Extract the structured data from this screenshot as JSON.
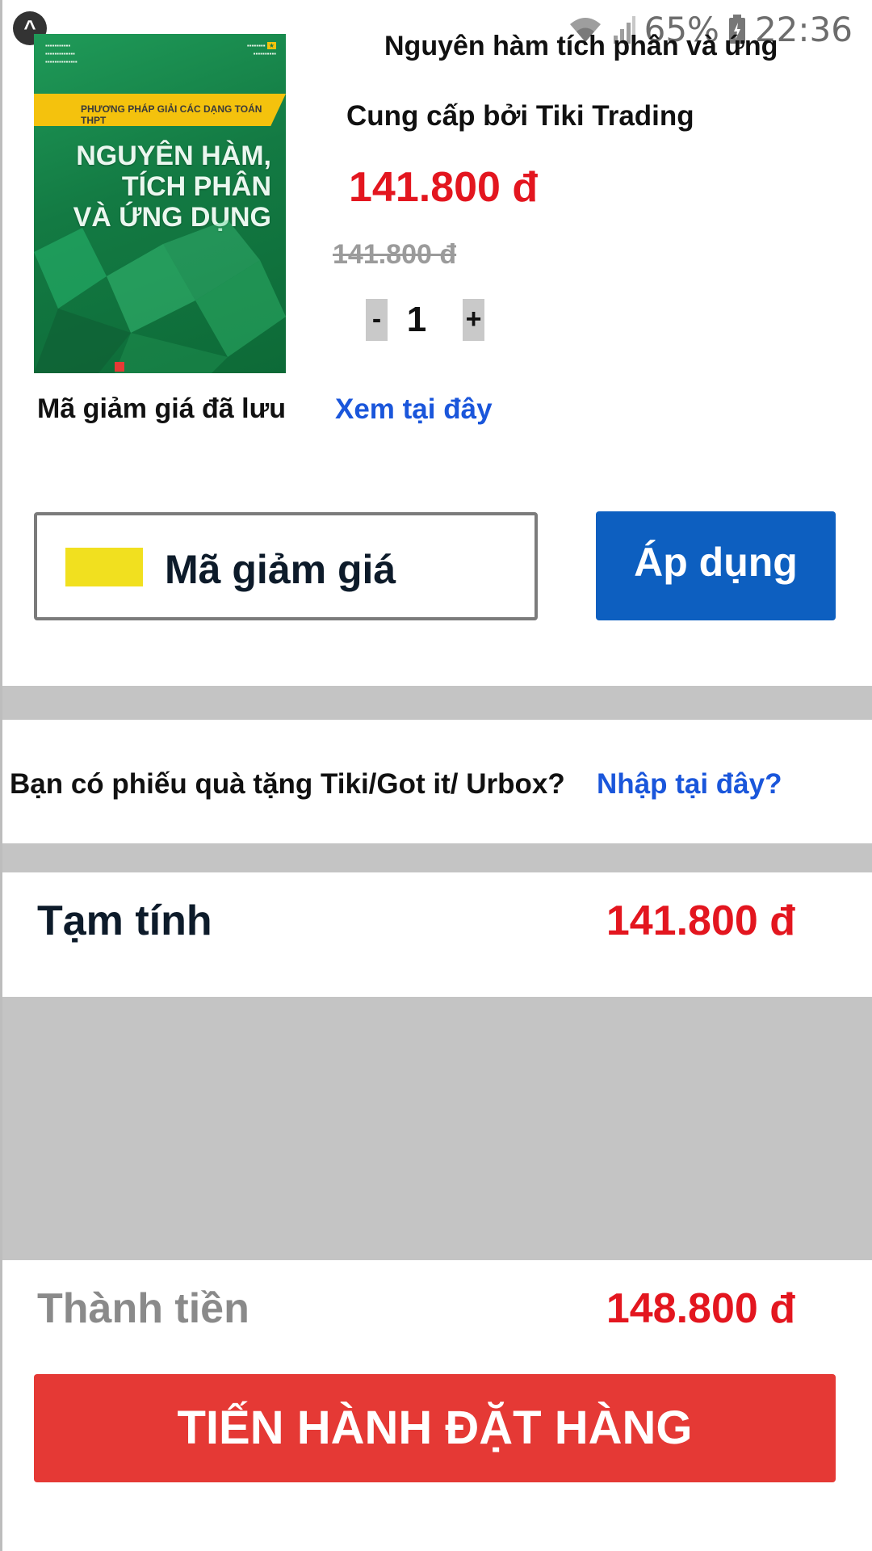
{
  "status_bar": {
    "app_badge": "^",
    "battery": "65%",
    "time": "22:36",
    "icons": [
      "wifi-icon",
      "signal-icon",
      "battery-icon"
    ]
  },
  "product": {
    "cover": {
      "top_left_text": "",
      "strip_text": "PHƯƠNG PHÁP GIẢI CÁC DẠNG TOÁN THPT",
      "title_line1": "NGUYÊN HÀM,",
      "title_line2": "TÍCH PHÂN",
      "title_line3": "VÀ ỨNG DỤNG"
    },
    "title": "Nguyên hàm tích phân và ứng",
    "seller": "Cung cấp bởi Tiki Trading",
    "price": "141.800 đ",
    "old_price": "141.800 đ",
    "qty_minus": "-",
    "quantity": "1",
    "qty_plus": "+"
  },
  "coupon": {
    "saved_label": "Mã giảm giá đã lưu",
    "view_link": "Xem tại đây",
    "placeholder": "Mã giảm giá",
    "apply_label": "Áp dụng"
  },
  "gift": {
    "question": "Bạn có phiếu quà tặng Tiki/Got it/ Urbox?",
    "link": "Nhập tại đây?"
  },
  "summary": {
    "subtotal_label": "Tạm tính",
    "subtotal_value": "141.800 đ",
    "total_label": "Thành tiền",
    "total_value": "148.800 đ"
  },
  "checkout_label": "TIẾN HÀNH ĐẶT HÀNG",
  "colors": {
    "price_red": "#e3161f",
    "link_blue": "#1a56db",
    "apply_blue": "#0d5fc0",
    "checkout_red": "#e53935",
    "divider_gray": "#c4c4c4"
  }
}
